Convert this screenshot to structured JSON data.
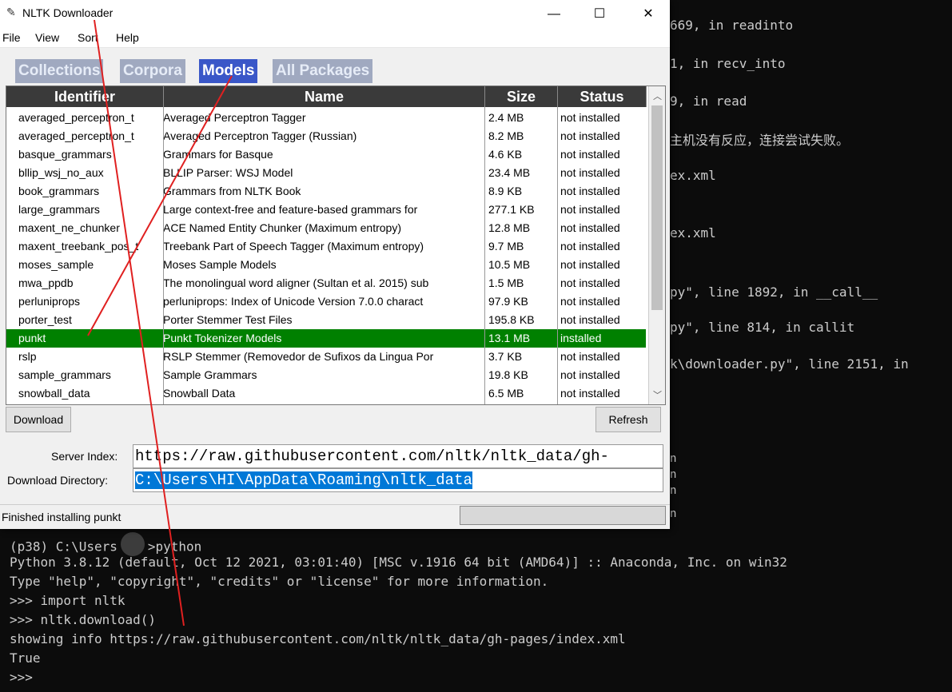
{
  "background_terminal": {
    "right_lines": [
      "669, in readinto",
      "1, in recv_into",
      "9, in read",
      "主机没有反应，连接尝试失败。",
      "ex.xml",
      "ex.xml",
      "py\", line 1892, in __call__",
      "py\", line 814, in callit",
      "k\\downloader.py\", line 2151, in",
      "n",
      "n",
      "n",
      "n"
    ],
    "bottom_lines": [
      "Python 3.8.12 (default, Oct 12 2021, 03:01:40) [MSC v.1916 64 bit (AMD64)] :: Anaconda, Inc. on win32",
      "Type \"help\", \"copyright\", \"credits\" or \"license\" for more information.",
      ">>> import nltk",
      ">>> nltk.download()",
      "showing info https://raw.githubusercontent.com/nltk/nltk_data/gh-pages/index.xml",
      "True",
      ">>>"
    ],
    "prompt_prefix": "(p38) C:\\Users",
    "prompt_suffix": ">python"
  },
  "window": {
    "title": "NLTK Downloader",
    "controls": {
      "minimize": "—",
      "maximize": "☐",
      "close": "✕"
    },
    "menu": [
      "File",
      "View",
      "Sort",
      "Help"
    ],
    "tabs": [
      {
        "label": "Collections",
        "active": false
      },
      {
        "label": "Corpora",
        "active": false
      },
      {
        "label": "Models",
        "active": true
      },
      {
        "label": "All Packages",
        "active": false
      }
    ],
    "table": {
      "columns": [
        "Identifier",
        "Name",
        "Size",
        "Status"
      ],
      "rows": [
        [
          "averaged_perceptron_t",
          "Averaged Perceptron Tagger",
          "2.4 MB",
          "not installed"
        ],
        [
          "averaged_perceptron_t",
          "Averaged Perceptron Tagger (Russian)",
          "8.2 MB",
          "not installed"
        ],
        [
          "basque_grammars",
          "Grammars for Basque",
          "4.6 KB",
          "not installed"
        ],
        [
          "bllip_wsj_no_aux",
          "BLLIP Parser: WSJ Model",
          "23.4 MB",
          "not installed"
        ],
        [
          "book_grammars",
          "Grammars from NLTK Book",
          "8.9 KB",
          "not installed"
        ],
        [
          "large_grammars",
          "Large context-free and feature-based grammars for",
          "277.1 KB",
          "not installed"
        ],
        [
          "maxent_ne_chunker",
          "ACE Named Entity Chunker (Maximum entropy)",
          "12.8 MB",
          "not installed"
        ],
        [
          "maxent_treebank_pos_t",
          "Treebank Part of Speech Tagger (Maximum entropy)",
          "9.7 MB",
          "not installed"
        ],
        [
          "moses_sample",
          "Moses Sample Models",
          "10.5 MB",
          "not installed"
        ],
        [
          "mwa_ppdb",
          "The monolingual word aligner (Sultan et al. 2015) sub",
          "1.5 MB",
          "not installed"
        ],
        [
          "perluniprops",
          "perluniprops: Index of Unicode Version 7.0.0 charact",
          "97.9 KB",
          "not installed"
        ],
        [
          "porter_test",
          "Porter Stemmer Test Files",
          "195.8 KB",
          "not installed"
        ],
        [
          "punkt",
          "Punkt Tokenizer Models",
          "13.1 MB",
          "installed"
        ],
        [
          "rslp",
          "RSLP Stemmer (Removedor de Sufixos da Lingua Por",
          "3.7 KB",
          "not installed"
        ],
        [
          "sample_grammars",
          "Sample Grammars",
          "19.8 KB",
          "not installed"
        ],
        [
          "snowball_data",
          "Snowball Data",
          "6.5 MB",
          "not installed"
        ]
      ],
      "selected_index": 12
    },
    "buttons": {
      "download": "Download",
      "refresh": "Refresh"
    },
    "server_index_label": "Server Index:",
    "server_index_value": "https://raw.githubusercontent.com/nltk/nltk_data/gh-",
    "download_dir_label": "Download Directory:",
    "download_dir_value": "C:\\Users\\HI\\AppData\\Roaming\\nltk_data",
    "status_text": "Finished installing punkt",
    "progress": 0
  },
  "colors": {
    "annotation": "#e02020",
    "selected_row": "#008000",
    "active_tab": "#3a57c8"
  }
}
